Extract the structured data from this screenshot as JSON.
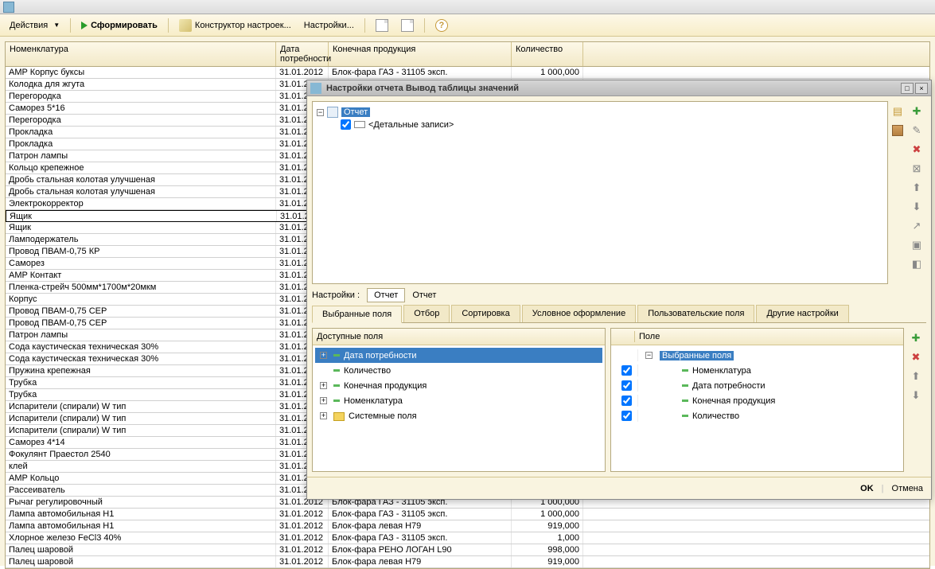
{
  "toolbar": {
    "actions": "Действия",
    "generate": "Сформировать",
    "constructor": "Конструктор настроек...",
    "settings": "Настройки..."
  },
  "grid": {
    "headers": {
      "nomenclature": "Номенклатура",
      "date": "Дата потребности",
      "product": "Конечная продукция",
      "qty": "Количество"
    },
    "rows": [
      {
        "nom": "AMP Корпус буксы",
        "date": "31.01.2012",
        "prod": "Блок-фара ГАЗ - 31105 эксп.",
        "qty": "1 000,000"
      },
      {
        "nom": "Колодка для жгута",
        "date": "31.01.201",
        "prod": "",
        "qty": ""
      },
      {
        "nom": "Перегородка",
        "date": "31.01.201",
        "prod": "",
        "qty": ""
      },
      {
        "nom": "Саморез 5*16",
        "date": "31.01.201",
        "prod": "",
        "qty": ""
      },
      {
        "nom": "Перегородка",
        "date": "31.01.201",
        "prod": "",
        "qty": ""
      },
      {
        "nom": "Прокладка",
        "date": "31.01.201",
        "prod": "",
        "qty": ""
      },
      {
        "nom": "Прокладка",
        "date": "31.01.201",
        "prod": "",
        "qty": ""
      },
      {
        "nom": "Патрон лампы",
        "date": "31.01.201",
        "prod": "",
        "qty": ""
      },
      {
        "nom": "Кольцо крепежное",
        "date": "31.01.201",
        "prod": "",
        "qty": ""
      },
      {
        "nom": "Дробь стальная колотая улучшеная",
        "date": "31.01.201",
        "prod": "",
        "qty": ""
      },
      {
        "nom": "Дробь стальная колотая улучшеная",
        "date": "31.01.201",
        "prod": "",
        "qty": ""
      },
      {
        "nom": "Электрокорректор",
        "date": "31.01.201",
        "prod": "",
        "qty": ""
      },
      {
        "nom": "Ящик",
        "date": "31.01.201",
        "prod": "",
        "qty": "",
        "selected": true
      },
      {
        "nom": "Ящик",
        "date": "31.01.201",
        "prod": "",
        "qty": ""
      },
      {
        "nom": "Ламподержатель",
        "date": "31.01.201",
        "prod": "",
        "qty": ""
      },
      {
        "nom": "Провод ПВАМ-0,75 КР",
        "date": "31.01.201",
        "prod": "",
        "qty": ""
      },
      {
        "nom": "Саморез",
        "date": "31.01.201",
        "prod": "",
        "qty": ""
      },
      {
        "nom": "AMP Контакт",
        "date": "31.01.201",
        "prod": "",
        "qty": ""
      },
      {
        "nom": "Пленка-стрейч 500мм*1700м*20мкм",
        "date": "31.01.201",
        "prod": "",
        "qty": ""
      },
      {
        "nom": "Корпус",
        "date": "31.01.201",
        "prod": "",
        "qty": ""
      },
      {
        "nom": "Провод ПВАМ-0,75 СЕР",
        "date": "31.01.201",
        "prod": "",
        "qty": ""
      },
      {
        "nom": "Провод ПВАМ-0,75 СЕР",
        "date": "31.01.201",
        "prod": "",
        "qty": ""
      },
      {
        "nom": "Патрон лампы",
        "date": "31.01.201",
        "prod": "",
        "qty": ""
      },
      {
        "nom": "Сода каустическая техническая 30%",
        "date": "31.01.201",
        "prod": "",
        "qty": ""
      },
      {
        "nom": "Сода каустическая техническая 30%",
        "date": "31.01.201",
        "prod": "",
        "qty": ""
      },
      {
        "nom": "Пружина крепежная",
        "date": "31.01.201",
        "prod": "",
        "qty": ""
      },
      {
        "nom": "Трубка",
        "date": "31.01.201",
        "prod": "",
        "qty": ""
      },
      {
        "nom": "Трубка",
        "date": "31.01.201",
        "prod": "",
        "qty": ""
      },
      {
        "nom": "Испарители (спирали) W тип",
        "date": "31.01.201",
        "prod": "",
        "qty": ""
      },
      {
        "nom": "Испарители (спирали) W тип",
        "date": "31.01.201",
        "prod": "",
        "qty": ""
      },
      {
        "nom": "Испарители (спирали) W тип",
        "date": "31.01.201",
        "prod": "",
        "qty": ""
      },
      {
        "nom": "Саморез 4*14",
        "date": "31.01.201",
        "prod": "",
        "qty": ""
      },
      {
        "nom": "Фокулянт Праестол 2540",
        "date": "31.01.201",
        "prod": "",
        "qty": ""
      },
      {
        "nom": "клей",
        "date": "31.01.201",
        "prod": "",
        "qty": ""
      },
      {
        "nom": "AMP Кольцо",
        "date": "31.01.201",
        "prod": "",
        "qty": ""
      },
      {
        "nom": "Рассеиватель",
        "date": "31.01.201",
        "prod": "",
        "qty": ""
      },
      {
        "nom": "Рычаг регулировочный",
        "date": "31.01.2012",
        "prod": "Блок-фара ГАЗ - 31105 эксп.",
        "qty": "1 000,000"
      },
      {
        "nom": "Лампа автомобильная Н1",
        "date": "31.01.2012",
        "prod": "Блок-фара ГАЗ - 31105 эксп.",
        "qty": "1 000,000"
      },
      {
        "nom": "Лампа автомобильная Н1",
        "date": "31.01.2012",
        "prod": "Блок-фара левая Н79",
        "qty": "919,000"
      },
      {
        "nom": "Хлорное железо FeCl3   40%",
        "date": "31.01.2012",
        "prod": "Блок-фара ГАЗ - 31105 эксп.",
        "qty": "1,000"
      },
      {
        "nom": "Палец шаровой",
        "date": "31.01.2012",
        "prod": "Блок-фара РЕНО ЛОГАН L90",
        "qty": "998,000"
      },
      {
        "nom": "Палец шаровой",
        "date": "31.01.2012",
        "prod": "Блок-фара левая Н79",
        "qty": "919,000"
      }
    ]
  },
  "dialog": {
    "title": "Настройки отчета  Вывод таблицы значений",
    "report": "Отчет",
    "detail": "<Детальные записи>",
    "settings_label": "Настройки :",
    "path1": "Отчет",
    "path2": "Отчет",
    "tabs": [
      "Выбранные поля",
      "Отбор",
      "Сортировка",
      "Условное оформление",
      "Пользовательские поля",
      "Другие настройки"
    ],
    "available_header": "Доступные поля",
    "field_header": "Поле",
    "available_fields": [
      {
        "label": "Дата потребности",
        "exp": true,
        "selected": true
      },
      {
        "label": "Количество",
        "exp": false
      },
      {
        "label": "Конечная продукция",
        "exp": true
      },
      {
        "label": "Номенклатура",
        "exp": true
      },
      {
        "label": "Системные поля",
        "exp": true,
        "folder": true
      }
    ],
    "selected_root": "Выбранные поля",
    "selected_fields": [
      "Номенклатура",
      "Дата потребности",
      "Конечная продукция",
      "Количество"
    ],
    "ok": "OK",
    "cancel": "Отмена"
  }
}
